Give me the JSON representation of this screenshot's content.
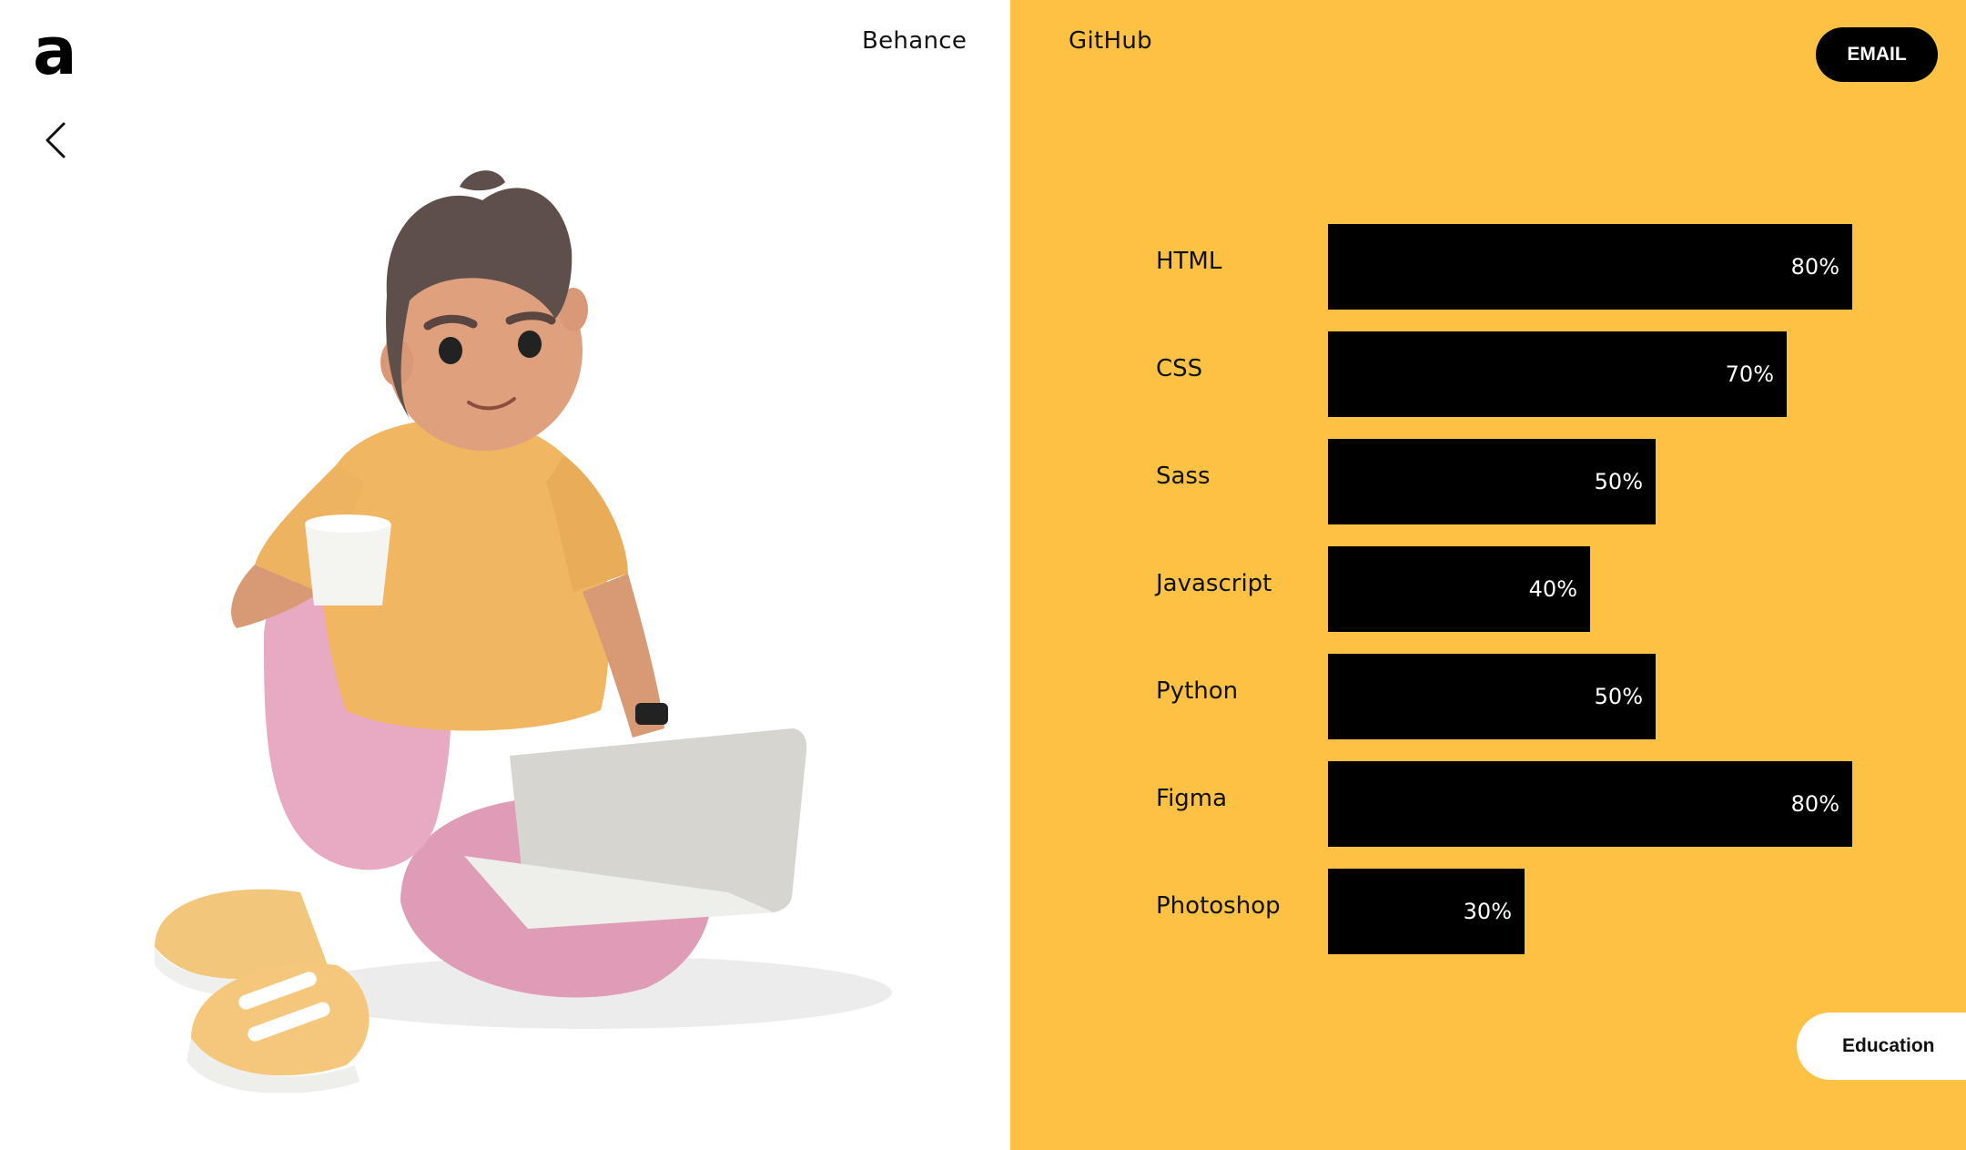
{
  "header": {
    "logo_text": "a",
    "nav": [
      {
        "label": "Behance"
      },
      {
        "label": "GitHub"
      }
    ],
    "email_label": "EMAIL"
  },
  "colors": {
    "accent": "#fdc243",
    "bar": "#000000",
    "background": "#ffffff"
  },
  "icons": {
    "back": "chevron-left-icon"
  },
  "skills": [
    {
      "name": "HTML",
      "percent": 80,
      "label": "80%"
    },
    {
      "name": "CSS",
      "percent": 70,
      "label": "70%"
    },
    {
      "name": "Sass",
      "percent": 50,
      "label": "50%"
    },
    {
      "name": "Javascript",
      "percent": 40,
      "label": "40%"
    },
    {
      "name": "Python",
      "percent": 50,
      "label": "50%"
    },
    {
      "name": "Figma",
      "percent": 80,
      "label": "80%"
    },
    {
      "name": "Photoshop",
      "percent": 30,
      "label": "30%"
    }
  ],
  "footer": {
    "education_label": "Education"
  }
}
